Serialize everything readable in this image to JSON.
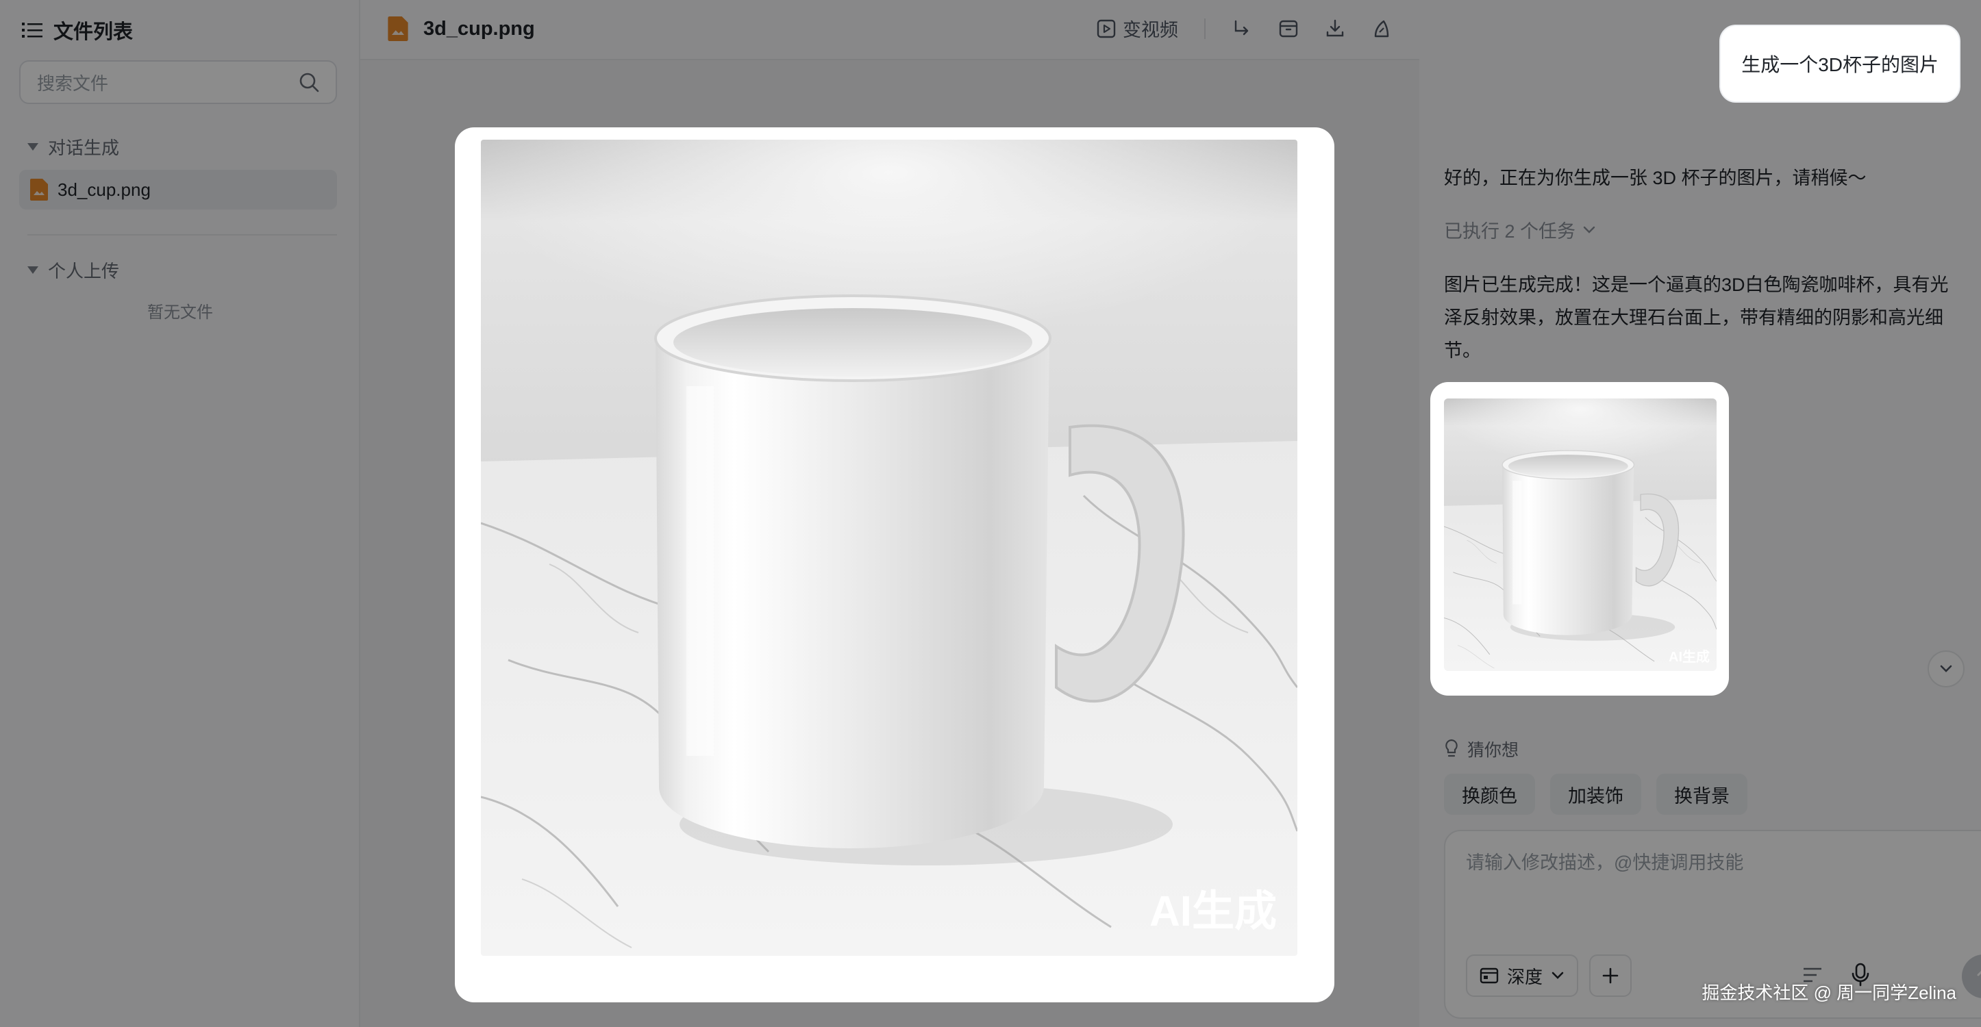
{
  "sidebar": {
    "title": "文件列表",
    "search_placeholder": "搜索文件",
    "group_conversation": "对话生成",
    "file_name": "3d_cup.png",
    "group_uploads": "个人上传",
    "empty_text": "暂无文件"
  },
  "center": {
    "file_name": "3d_cup.png",
    "tool_video": "变视频",
    "image_watermark": "AI生成"
  },
  "chat": {
    "user_message": "生成一个3D杯子的图片",
    "reply_1": "好的，正在为你生成一张 3D 杯子的图片，请稍候～",
    "tasks_label": "已执行 2 个任务",
    "reply_2": "图片已生成完成！这是一个逼真的3D白色陶瓷咖啡杯，具有光泽反射效果，放置在大理石台面上，带有精细的阴影和高光细节。",
    "thumb_watermark": "AI生成",
    "suggest_label": "猜你想",
    "chips": [
      "换颜色",
      "加装饰",
      "换背景"
    ],
    "composer_placeholder": "请输入修改描述，@快捷调用技能",
    "mode_label": "深度"
  },
  "footer_watermark": "掘金技术社区 @ 周一同学Zelina",
  "colors": {
    "overlay": "#000000",
    "accent_file": "#e8892b"
  }
}
